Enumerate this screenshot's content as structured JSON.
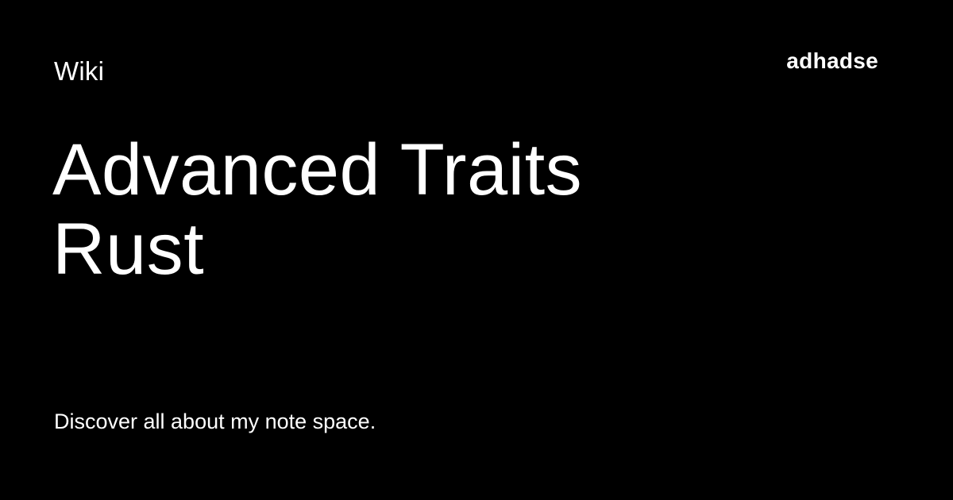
{
  "header": {
    "section_label": "Wiki",
    "brand": "adhadse"
  },
  "main": {
    "title_line_1": "Advanced Traits",
    "title_line_2": "Rust",
    "tagline": "Discover all about my note space."
  },
  "colors": {
    "background": "#000000",
    "text": "#ffffff"
  }
}
